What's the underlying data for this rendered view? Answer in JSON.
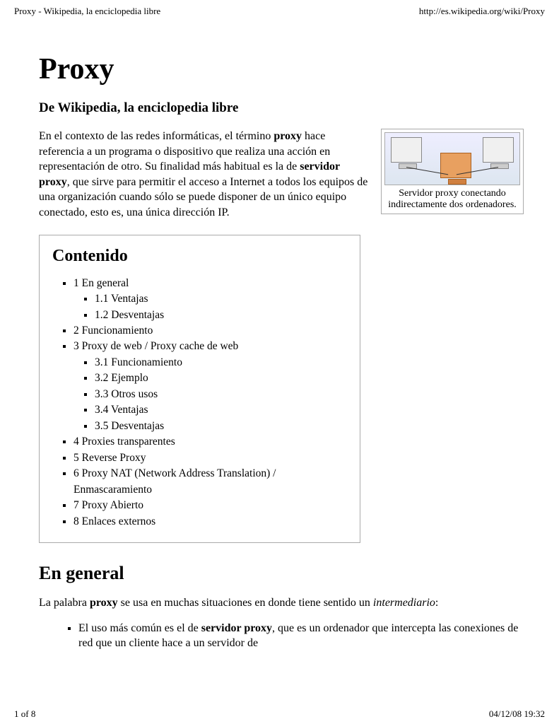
{
  "header": {
    "left": "Proxy - Wikipedia, la enciclopedia libre",
    "right": "http://es.wikipedia.org/wiki/Proxy"
  },
  "title": "Proxy",
  "subtitle": "De Wikipedia, la enciclopedia libre",
  "intro": {
    "pre": "En el contexto de las redes informáticas, el término ",
    "bold1": "proxy",
    "mid1": " hace referencia a un programa o dispositivo que realiza una acción en representación de otro. Su finalidad más habitual es la de ",
    "bold2": "servidor proxy",
    "mid2": ", que sirve para permitir el acceso a Internet a todos los equipos de una organización cuando sólo se puede disponer de un único equipo conectado, esto es, una única dirección IP."
  },
  "infobox_caption": "Servidor proxy conectando indirectamente dos ordenadores.",
  "toc": {
    "heading": "Contenido",
    "items": [
      {
        "label": "1 En general",
        "children": [
          {
            "label": "1.1 Ventajas"
          },
          {
            "label": "1.2 Desventajas"
          }
        ]
      },
      {
        "label": "2 Funcionamiento"
      },
      {
        "label": "3 Proxy de web / Proxy cache de web",
        "children": [
          {
            "label": "3.1 Funcionamiento"
          },
          {
            "label": "3.2 Ejemplo"
          },
          {
            "label": "3.3 Otros usos"
          },
          {
            "label": "3.4 Ventajas"
          },
          {
            "label": "3.5 Desventajas"
          }
        ]
      },
      {
        "label": "4 Proxies transparentes"
      },
      {
        "label": "5 Reverse Proxy"
      },
      {
        "label": "6 Proxy NAT (Network Address Translation) / Enmascaramiento"
      },
      {
        "label": "7 Proxy Abierto"
      },
      {
        "label": "8 Enlaces externos"
      }
    ]
  },
  "section_heading": "En general",
  "para2": {
    "pre": "La palabra ",
    "bold": "proxy",
    "mid": " se usa en muchas situaciones en donde tiene sentido un ",
    "em": "intermediario",
    "post": ":"
  },
  "listitem": {
    "pre": "El uso más común es el de ",
    "bold": "servidor proxy",
    "post": ", que es un ordenador que intercepta las conexiones de red que un cliente hace a un servidor de"
  },
  "footer": {
    "left": "1 of 8",
    "right": "04/12/08 19:32"
  }
}
